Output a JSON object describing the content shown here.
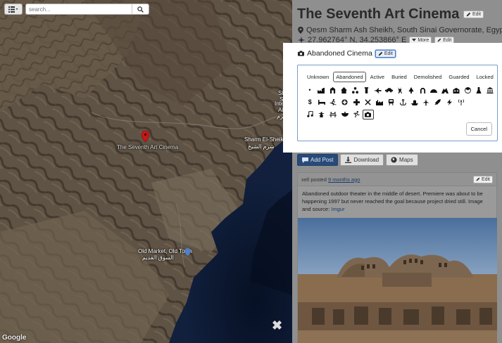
{
  "map": {
    "search_placeholder": "search...",
    "labels": {
      "pin": "The Seventh Art Cinema",
      "city_en": "Sharm El-Sheikh",
      "city_ar": "شرم الشيخ",
      "edge_1": "Shar",
      "edge_2": "Sh",
      "edge_3": "Interna",
      "edge_4": "Air",
      "edge_5": "أشرم",
      "market_en": "Old Market, Old Town",
      "market_ar": "السوق القديم"
    },
    "google": "Google",
    "close": "✖"
  },
  "place": {
    "title": "The Seventh Art Cinema",
    "edit_label": "Edit",
    "address": "Qesm Sharm Ash Sheikh, South Sinai Governorate, Egypt",
    "coords": "27.962764° N, 34.253866° E",
    "more_label": "More",
    "coord_edit_label": "Edit"
  },
  "actions": {
    "add_post": "Add Post",
    "download": "Download",
    "maps": "Maps"
  },
  "post": {
    "author": "xell",
    "posted_word": "posted",
    "time": "9 months ago",
    "edit_label": "Edit",
    "text": "Abandoned outdoor theater in the middle of desert. Premiere was about to be happening 1997 but never reached the goal because project dried still. Image and source:",
    "source": "Imgur"
  },
  "modal": {
    "category": "Abandoned Cinema",
    "edit_label": "Edit",
    "statuses": [
      "Unknown",
      "Abandoned",
      "Active",
      "Buried",
      "Demolished",
      "Guarded",
      "Locked"
    ],
    "selected_status": "Abandoned",
    "cancel_label": "Cancel",
    "icon_rows": [
      [
        "dot-icon",
        "factory-icon",
        "bunker-icon",
        "house-icon",
        "molecule-icon",
        "chemistry-icon",
        "airplane-icon",
        "car-icon",
        "deer-icon",
        "tree-icon",
        "horseshoe-icon",
        "dome-icon",
        "cave-icon",
        "school-icon",
        "radiation-icon",
        "flask-icon",
        "bank-icon"
      ],
      [
        "dollar-icon",
        "bed-icon",
        "skier-icon",
        "hospital-icon",
        "cross-icon",
        "tools-icon",
        "industry-icon",
        "train-icon",
        "anchor-icon",
        "ship-icon",
        "plane-icon",
        "rocket-icon",
        "lightning-icon",
        "antenna-icon"
      ],
      [
        "music-icon",
        "tower-icon",
        "bridge-icon",
        "bowl-icon",
        "runner-icon",
        "camera-icon"
      ]
    ],
    "selected_icon": "camera-icon"
  },
  "colors": {
    "primary_button": "#284a7a",
    "link": "#1d3c6b",
    "selection_border": "#4a7ed0",
    "pin": "#c91818"
  }
}
